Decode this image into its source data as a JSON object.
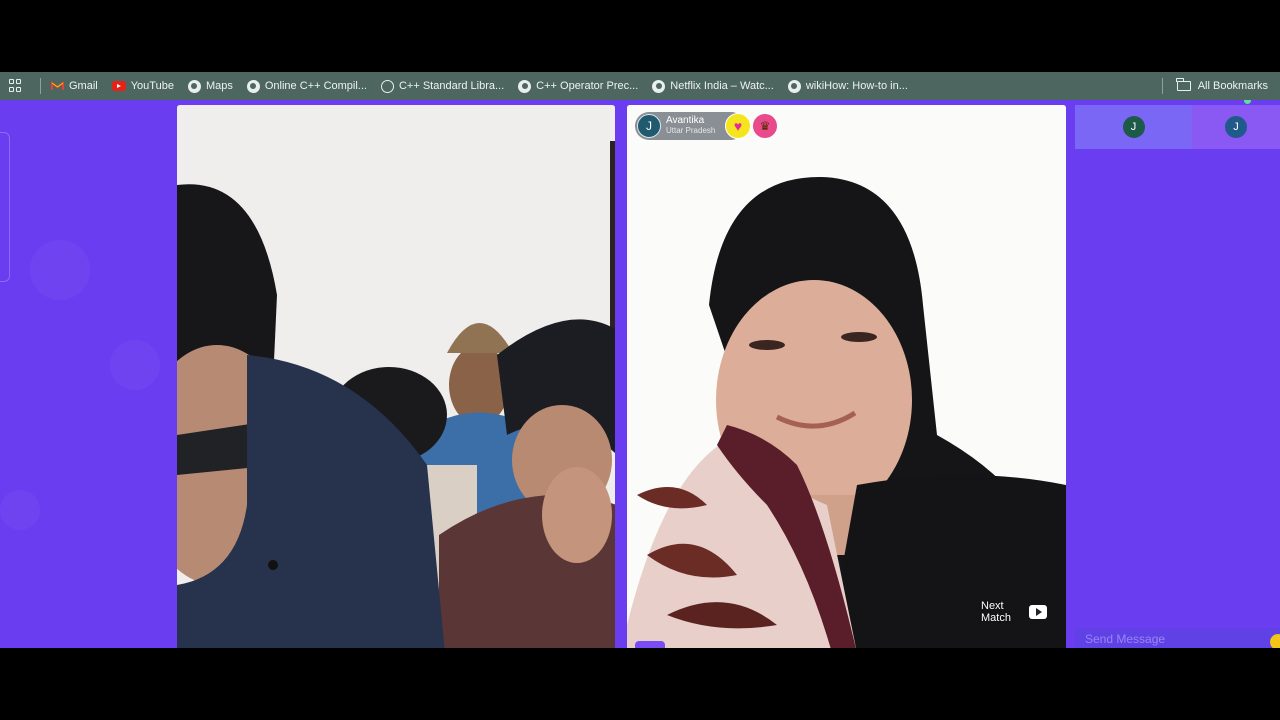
{
  "bookmarks_bar": {
    "apps_icon": "apps-grid-icon",
    "items": [
      {
        "label": "Gmail",
        "icon": "gmail-icon"
      },
      {
        "label": "YouTube",
        "icon": "youtube-icon"
      },
      {
        "label": "Maps",
        "icon": "globe-icon"
      },
      {
        "label": "Online C++ Compil...",
        "icon": "globe-icon"
      },
      {
        "label": "C++ Standard Libra...",
        "icon": "cpp-icon"
      },
      {
        "label": "C++ Operator Prec...",
        "icon": "globe-icon"
      },
      {
        "label": "Netflix India – Watc...",
        "icon": "globe-icon"
      },
      {
        "label": "wikiHow: How-to in...",
        "icon": "globe-icon"
      }
    ],
    "all_bookmarks": "All Bookmarks"
  },
  "match": {
    "avatar_initial": "J",
    "name": "Avantika",
    "location": "Uttar Pradesh",
    "heart_icon": "heart-icon",
    "gift_icon": "gift-icon"
  },
  "controls": {
    "next_match_label": "Next Match"
  },
  "side_panel": {
    "tab1_initial": "J",
    "tab2_initial": "J",
    "message_placeholder": "Send Message"
  },
  "colors": {
    "app_background": "#6a3df0",
    "bookmarks_bar": "#4e6660",
    "heart_badge": "#f5e51c",
    "online_dot": "#5ce0a0"
  }
}
